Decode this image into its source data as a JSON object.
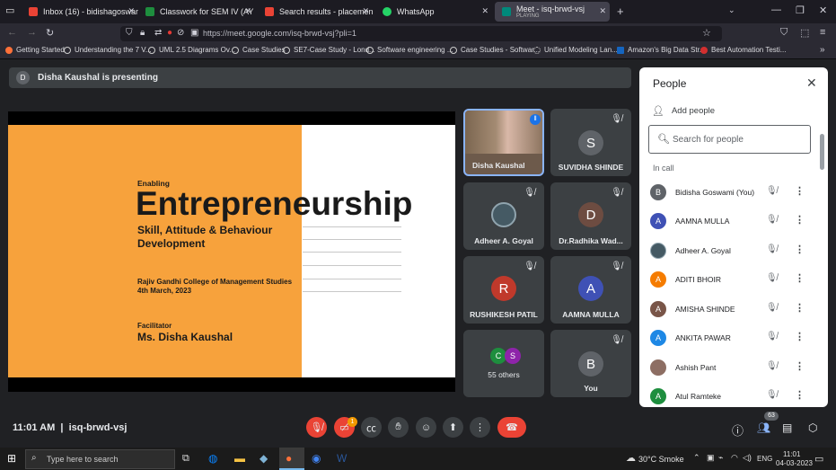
{
  "browser": {
    "tabs": [
      {
        "title": "Inbox (16) - bidishagoswami@",
        "color": "#ea4335",
        "active": false
      },
      {
        "title": "Classwork for SEM IV (AY 22-23",
        "color": "#1e8e3e",
        "active": false
      },
      {
        "title": "Search results - placement@",
        "color": "#ea4335",
        "active": false
      },
      {
        "title": "WhatsApp",
        "color": "#25d366",
        "active": false
      },
      {
        "title": "Meet - isq-brwd-vsj",
        "subtitle": "PLAYING",
        "color": "#00897b",
        "active": true
      }
    ],
    "url": "https://meet.google.com/isq-brwd-vsj?pli=1",
    "bookmarks": [
      "Getting Started",
      "Understanding the 7 V...",
      "UML 2.5 Diagrams Ov...",
      "Case Studies",
      "SE7-Case Study - Lond...",
      "Software engineering ...",
      "Case Studies - Softwar...",
      "Unified Modeling Lan...",
      "Amazon's Big Data Str...",
      "Best Automation Testi..."
    ]
  },
  "meet": {
    "presenting_avatar": "D",
    "presenting_text": "Disha Kaushal is presenting",
    "slide": {
      "kicker": "Enabling",
      "title": "Entrepreneurship",
      "subtitle_line1": "Skill, Attitude & Behaviour",
      "subtitle_line2": "Development",
      "college": "Rajiv Gandhi College of Management Studies",
      "date": "4th March, 2023",
      "facilitator_label": "Facilitator",
      "facilitator_name": "Ms. Disha Kaushal"
    },
    "tiles": [
      {
        "name": "Disha Kaushal",
        "initial": "",
        "color": "#8d6e63"
      },
      {
        "name": "SUVIDHA SHINDE",
        "initial": "S",
        "color": "#5f6368"
      },
      {
        "name": "Adheer A. Goyal",
        "initial": "",
        "color": "#455a64"
      },
      {
        "name": "Dr.Radhika Wad...",
        "initial": "D",
        "color": "#6d4c41"
      },
      {
        "name": "RUSHIKESH PATIL",
        "initial": "R",
        "color": "#c0392b"
      },
      {
        "name": "AAMNA MULLA",
        "initial": "A",
        "color": "#3f51b5"
      },
      {
        "name": "55 others",
        "initial": "C",
        "initial2": "S",
        "color": "#1e8e3e",
        "color2": "#8e24aa"
      },
      {
        "name": "You",
        "initial": "B",
        "color": "#5f6368"
      }
    ],
    "people_panel": {
      "title": "People",
      "add_people": "Add people",
      "search_placeholder": "Search for people",
      "section": "In call",
      "people": [
        {
          "name": "Bidisha Goswami (You)",
          "initial": "B",
          "color": "#5f6368"
        },
        {
          "name": "AAMNA MULLA",
          "initial": "A",
          "color": "#3f51b5"
        },
        {
          "name": "Adheer A. Goyal",
          "initial": "",
          "color": "#455a64"
        },
        {
          "name": "ADITI BHOIR",
          "initial": "A",
          "color": "#f57c00"
        },
        {
          "name": "AMISHA SHINDE",
          "initial": "A",
          "color": "#795548"
        },
        {
          "name": "ANKITA PAWAR",
          "initial": "A",
          "color": "#1e88e5"
        },
        {
          "name": "Ashish Pant",
          "initial": "",
          "color": "#8d6e63"
        },
        {
          "name": "Atul Ramteke",
          "initial": "A",
          "color": "#1e8e3e"
        }
      ]
    },
    "bottom": {
      "time_code": "11:01 AM  |  isq-brwd-vsj",
      "notification_count": "1",
      "participant_count": "63"
    }
  },
  "taskbar": {
    "search_placeholder": "Type here to search",
    "weather": "30°C  Smoke",
    "lang": "ENG",
    "clock_time": "11:01",
    "clock_date": "04-03-2023"
  }
}
